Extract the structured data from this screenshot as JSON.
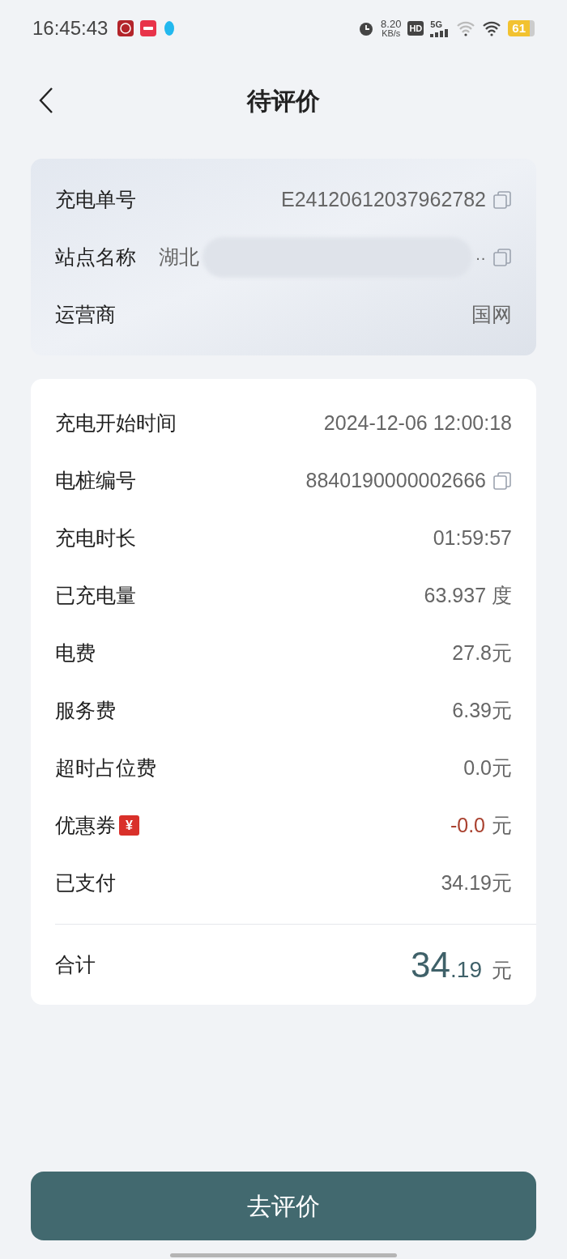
{
  "status_bar": {
    "time": "16:45:43",
    "speed": "8.20",
    "speed_unit": "KB/s",
    "hd": "HD",
    "network": "5G",
    "battery": "61"
  },
  "header": {
    "title": "待评价"
  },
  "order_card": {
    "rows": [
      {
        "kind": "copy",
        "label": "充电单号",
        "value": "E24120612037962782"
      },
      {
        "kind": "redacted",
        "label": "站点名称",
        "value": "湖北",
        "tail": "··"
      },
      {
        "kind": "plain",
        "label": "运营商",
        "value": "国网"
      }
    ]
  },
  "detail_card": {
    "rows": [
      {
        "kind": "plain",
        "label": "充电开始时间",
        "value": "2024-12-06 12:00:18"
      },
      {
        "kind": "copy",
        "label": "电桩编号",
        "value": "8840190000002666"
      },
      {
        "kind": "plain",
        "label": "充电时长",
        "value": "01:59:57"
      },
      {
        "kind": "plain",
        "label": "已充电量",
        "value": "63.937 度"
      },
      {
        "kind": "plain",
        "label": "电费",
        "value": "27.8元"
      },
      {
        "kind": "plain",
        "label": "服务费",
        "value": "6.39元"
      },
      {
        "kind": "plain",
        "label": "超时占位费",
        "value": "0.0元"
      },
      {
        "kind": "coupon",
        "label": "优惠券",
        "badge": "¥",
        "value": "-0.0",
        "unit": "元"
      },
      {
        "kind": "plain",
        "label": "已支付",
        "value": "34.19元"
      }
    ],
    "total": {
      "label": "合计",
      "integer": "34",
      "decimal": ".19",
      "unit": "元"
    }
  },
  "action_button": {
    "label": "去评价"
  }
}
